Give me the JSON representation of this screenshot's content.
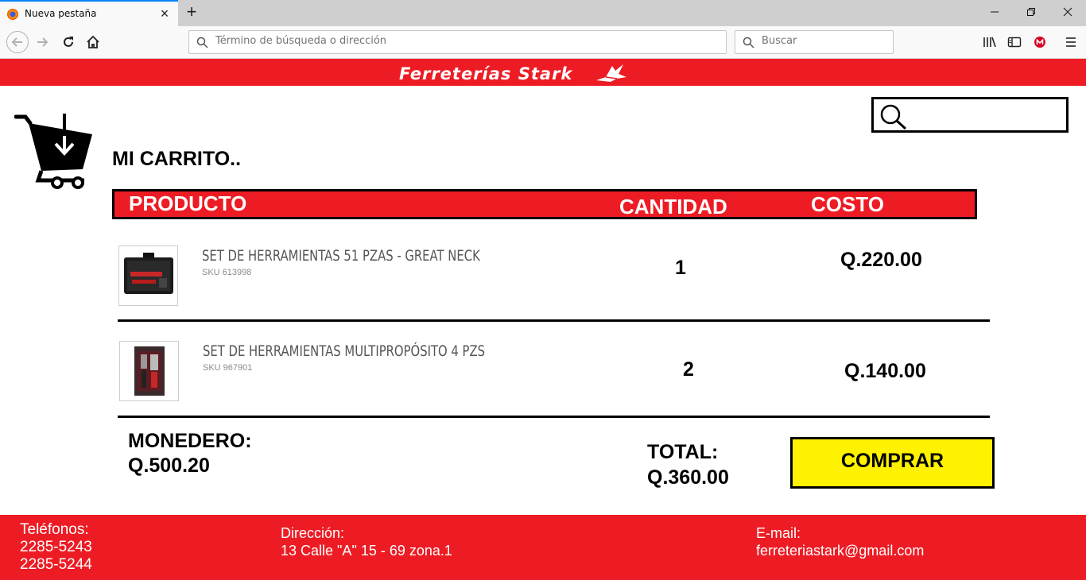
{
  "browser": {
    "tab_title": "Nueva pestaña",
    "url_placeholder": "Término de búsqueda o dirección",
    "search_placeholder": "Buscar"
  },
  "header": {
    "brand": "Ferreterías Stark"
  },
  "page": {
    "title": "MI CARRITO.."
  },
  "table": {
    "col_product": "PRODUCTO",
    "col_quantity": "CANTIDAD",
    "col_cost": "COSTO"
  },
  "items": [
    {
      "name": "SET DE HERRAMIENTAS 51 PZAS - GREAT NECK",
      "sku": "SKU 613998",
      "quantity": "1",
      "cost": "Q.220.00"
    },
    {
      "name": "SET DE HERRAMIENTAS MULTIPROPÓSITO 4 PZS",
      "sku": "SKU 967901",
      "quantity": "2",
      "cost": "Q.140.00"
    }
  ],
  "summary": {
    "wallet_label": "MONEDERO:",
    "wallet_value": "Q.500.20",
    "total_label": "TOTAL:",
    "total_value": "Q.360.00",
    "buy_label": "COMPRAR"
  },
  "footer": {
    "phones_label": "Teléfonos:",
    "phone_1": "2285-5243",
    "phone_2": "2285-5244",
    "address_label": "Dirección:",
    "address_value": "13 Calle \"A\" 15 - 69 zona.1",
    "email_label": "E-mail:",
    "email_value": "ferreteriastark@gmail.com"
  },
  "colors": {
    "brand_red": "#ed1c24",
    "buy_yellow": "#fff200"
  }
}
